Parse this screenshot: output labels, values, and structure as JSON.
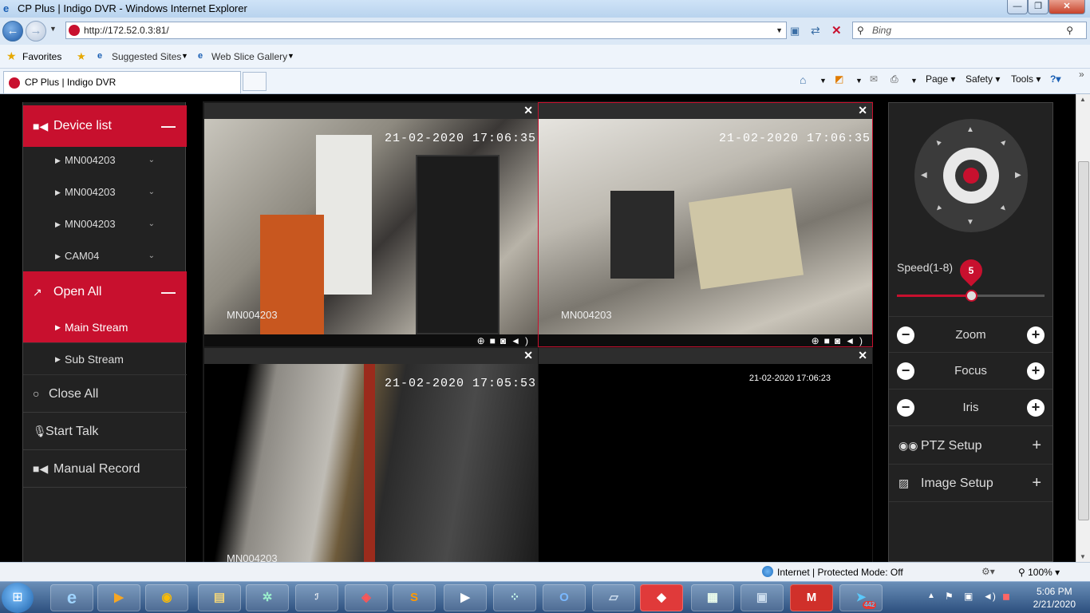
{
  "window": {
    "title": "CP Plus | Indigo DVR - Windows Internet Explorer"
  },
  "address": {
    "url": "http://172.52.0.3:81/",
    "search_placeholder": "Bing"
  },
  "favorites": {
    "label": "Favorites",
    "items": [
      "Suggested Sites",
      "Web Slice Gallery"
    ]
  },
  "tab": {
    "title": "CP Plus | Indigo DVR"
  },
  "toolbar": {
    "page": "Page",
    "safety": "Safety",
    "tools": "Tools"
  },
  "sidebar": {
    "device_list": "Device list",
    "devices": [
      "MN004203",
      "MN004203",
      "MN004203",
      "CAM04"
    ],
    "open_all": "Open All",
    "streams": [
      "Main Stream",
      "Sub Stream"
    ],
    "close_all": "Close All",
    "start_talk": "Start Talk",
    "manual_record": "Manual Record"
  },
  "cameras": [
    {
      "timestamp": "21-02-2020 17:06:35",
      "label": "MN004203"
    },
    {
      "timestamp": "21-02-2020 17:06:35",
      "label": "MN004203"
    },
    {
      "timestamp": "21-02-2020 17:05:53",
      "label": "MN004203"
    },
    {
      "timestamp": "21-02-2020 17:06:23",
      "label": ""
    }
  ],
  "ptz": {
    "speed_label": "Speed(1-8)",
    "speed_value": "5",
    "speed_fraction": 0.5,
    "zoom": "Zoom",
    "focus": "Focus",
    "iris": "Iris",
    "ptz_setup": "PTZ Setup",
    "image_setup": "Image Setup"
  },
  "status": {
    "zone": "Internet | Protected Mode: Off",
    "zoom": "100%"
  },
  "taskbar": {
    "time": "5:06 PM",
    "date": "2/21/2020",
    "telegram_badge": "442"
  },
  "colors": {
    "accent": "#c8102e",
    "panel": "#222222"
  }
}
